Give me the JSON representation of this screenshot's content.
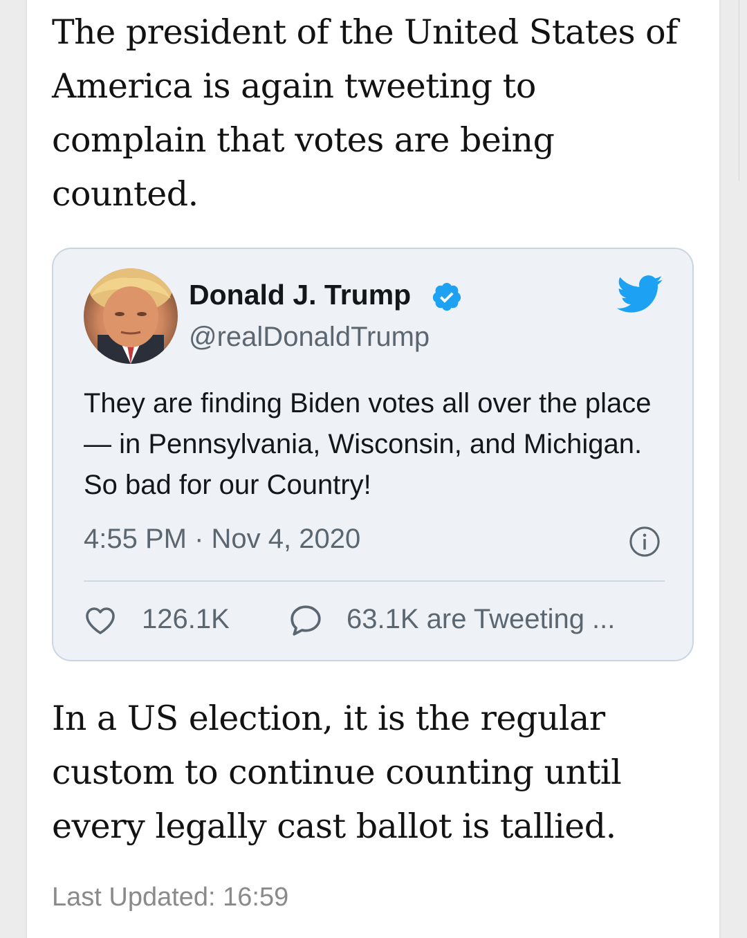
{
  "article": {
    "paragraph_1": "The president of the United States of America is again tweeting to complain that votes are being counted.",
    "paragraph_2": "In a US election, it is the regular custom to continue counting until every legally cast ballot is tallied.",
    "last_updated": "Last Updated: 16:59"
  },
  "tweet": {
    "author_name": "Donald J. Trump",
    "handle": "@realDonaldTrump",
    "text": "They are finding Biden votes all over the place — in Pennsylvania, Wisconsin, and Michigan. So bad for our Country!",
    "timestamp": "4:55 PM · Nov 4, 2020",
    "likes": "126.1K",
    "tweeting": "63.1K are Tweeting ...",
    "icons": {
      "verified": "verified-badge-icon",
      "brand": "twitter-bird-icon",
      "info": "info-icon",
      "like": "heart-icon",
      "reply": "speech-bubble-icon"
    }
  },
  "colors": {
    "twitter_blue": "#1da1f2",
    "tweet_background": "#eef2f6",
    "secondary_text": "#5b6670"
  }
}
